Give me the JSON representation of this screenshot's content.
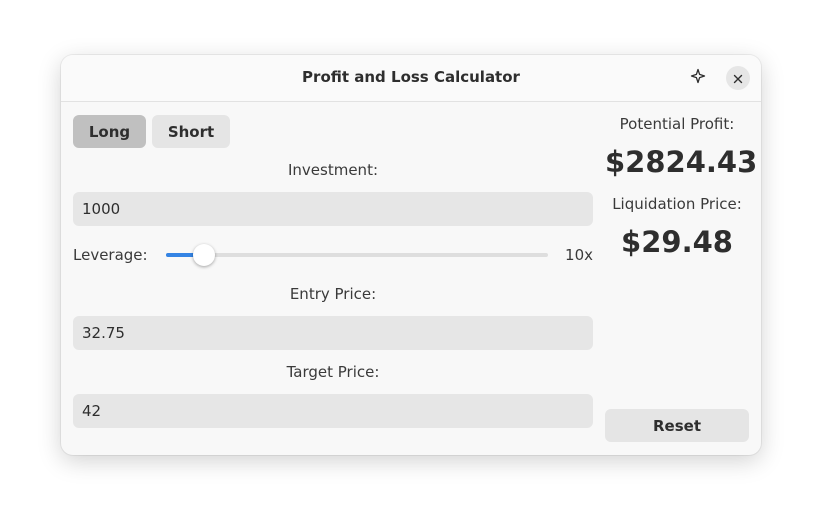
{
  "window": {
    "title": "Profit and Loss Calculator"
  },
  "position_toggle": {
    "long_label": "Long",
    "short_label": "Short",
    "selected": "Long"
  },
  "investment": {
    "label": "Investment:",
    "value": "1000"
  },
  "leverage": {
    "label": "Leverage:",
    "value_text": "10x",
    "slider_fraction": 0.1
  },
  "entry_price": {
    "label": "Entry Price:",
    "value": "32.75"
  },
  "target_price": {
    "label": "Target Price:",
    "value": "42"
  },
  "results": {
    "profit_label": "Potential Profit:",
    "profit_value": "$2824.43",
    "liquidation_label": "Liquidation Price:",
    "liquidation_value": "$29.48"
  },
  "reset_label": "Reset",
  "colors": {
    "accent": "#3584e4",
    "selected_toggle": "#c0c0c0",
    "input_bg": "#e6e6e6"
  },
  "icons": {
    "pin": "pin-icon",
    "close": "close-icon"
  }
}
